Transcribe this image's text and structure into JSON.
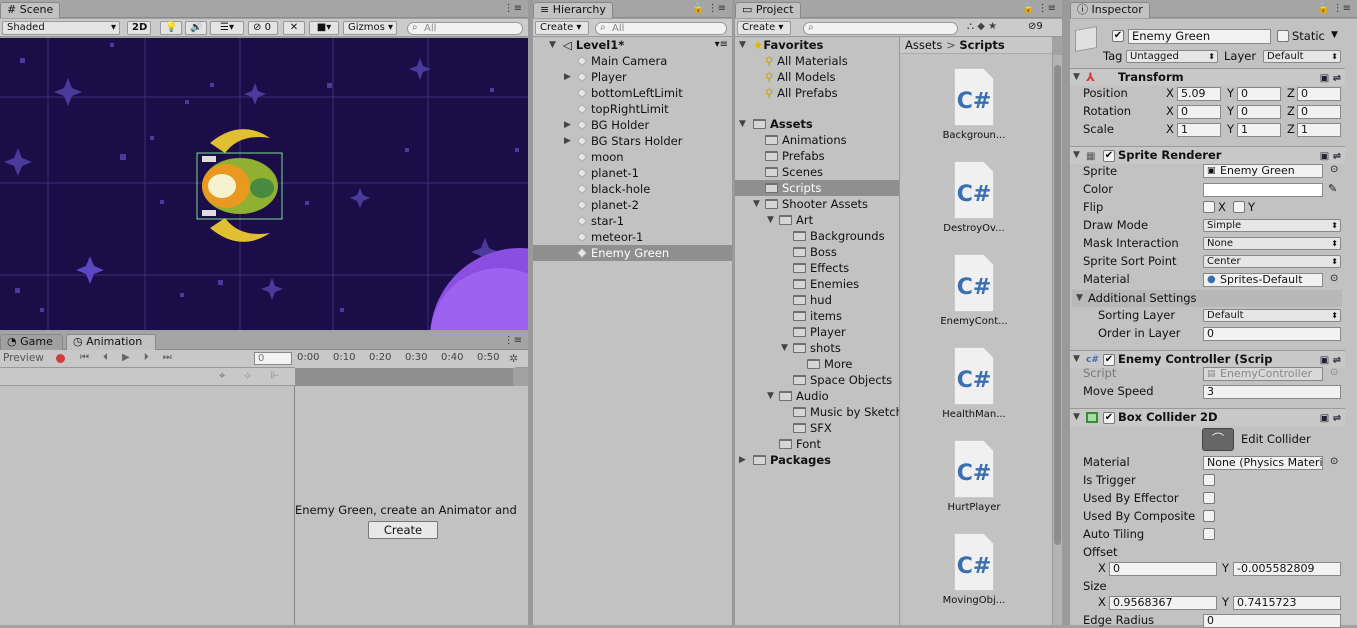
{
  "scene": {
    "tab": "Scene",
    "shading": "Shaded",
    "mode_2d": "2D",
    "hidden_count": "0",
    "gizmos": "Gizmos",
    "search_placeholder": "All"
  },
  "animation": {
    "tab_game": "Game",
    "tab_animation": "Animation",
    "preview": "Preview",
    "frame": "0",
    "timeline": [
      "0:00",
      "0:10",
      "0:20",
      "0:30",
      "0:40",
      "0:50"
    ],
    "message": "Enemy Green, create an Animator and",
    "create_button": "Create"
  },
  "hierarchy": {
    "tab": "Hierarchy",
    "create": "Create",
    "search_placeholder": "All",
    "scene_name": "Level1*",
    "items": [
      "Main Camera",
      "Player",
      "bottomLeftLimit",
      "topRightLimit",
      "BG Holder",
      "BG Stars Holder",
      "moon",
      "planet-1",
      "black-hole",
      "planet-2",
      "star-1",
      "meteor-1",
      "Enemy Green"
    ]
  },
  "project": {
    "tab": "Project",
    "create": "Create",
    "hidden_count": "9",
    "favorites": "Favorites",
    "fav_items": [
      "All Materials",
      "All Models",
      "All Prefabs"
    ],
    "assets": "Assets",
    "tree": [
      "Animations",
      "Prefabs",
      "Scenes",
      "Scripts",
      "Shooter Assets",
      "Art",
      "Backgrounds",
      "Boss",
      "Effects",
      "Enemies",
      "hud",
      "items",
      "Player",
      "shots",
      "More",
      "Space Objects",
      "Audio",
      "Music by Sketch",
      "SFX",
      "Font",
      "Packages"
    ],
    "breadcrumb": [
      "Assets",
      "Scripts"
    ],
    "files": [
      "Backgroun...",
      "DestroyOv...",
      "EnemyCont...",
      "HealthMan...",
      "HurtPlayer",
      "MovingObj..."
    ],
    "file_icon_text": "C#"
  },
  "inspector": {
    "tab": "Inspector",
    "object_name": "Enemy Green",
    "static_label": "Static",
    "tag_label": "Tag",
    "tag_value": "Untagged",
    "layer_label": "Layer",
    "layer_value": "Default",
    "transform": {
      "title": "Transform",
      "position_label": "Position",
      "rotation_label": "Rotation",
      "scale_label": "Scale",
      "x": "X",
      "y": "Y",
      "z": "Z",
      "position": [
        "5.09",
        "0",
        "0"
      ],
      "rotation": [
        "0",
        "0",
        "0"
      ],
      "scale": [
        "1",
        "1",
        "1"
      ]
    },
    "sprite_renderer": {
      "title": "Sprite Renderer",
      "sprite_label": "Sprite",
      "sprite_value": "Enemy Green",
      "color_label": "Color",
      "flip_label": "Flip",
      "flip_x": "X",
      "flip_y": "Y",
      "draw_mode_label": "Draw Mode",
      "draw_mode_value": "Simple",
      "mask_label": "Mask Interaction",
      "mask_value": "None",
      "sort_point_label": "Sprite Sort Point",
      "sort_point_value": "Center",
      "material_label": "Material",
      "material_value": "Sprites-Default",
      "additional": "Additional Settings",
      "sorting_layer_label": "Sorting Layer",
      "sorting_layer_value": "Default",
      "order_label": "Order in Layer",
      "order_value": "0"
    },
    "enemy_controller": {
      "title": "Enemy Controller (Scrip",
      "script_label": "Script",
      "script_value": "EnemyController",
      "move_speed_label": "Move Speed",
      "move_speed_value": "3"
    },
    "box_collider": {
      "title": "Box Collider 2D",
      "edit_collider": "Edit Collider",
      "material_label": "Material",
      "material_value": "None (Physics Materi",
      "is_trigger": "Is Trigger",
      "used_by_effector": "Used By Effector",
      "used_by_composite": "Used By Composite",
      "auto_tiling": "Auto Tiling",
      "offset_label": "Offset",
      "offset_x": "0",
      "offset_y": "-0.005582809",
      "size_label": "Size",
      "size_x": "0.9568367",
      "size_y": "0.7415723",
      "edge_radius_label": "Edge Radius",
      "edge_radius_value": "0"
    }
  }
}
